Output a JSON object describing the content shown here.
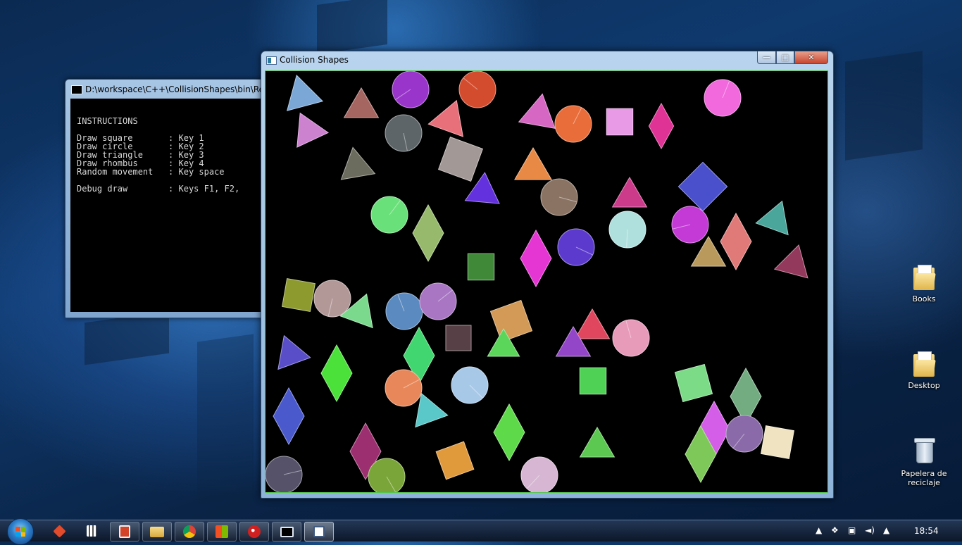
{
  "console": {
    "title": "D:\\workspace\\C++\\CollisionShapes\\bin\\Releas",
    "lines": [
      "INSTRUCTIONS",
      "Draw square       : Key 1",
      "Draw circle       : Key 2",
      "Draw triangle     : Key 3",
      "Draw rhombus      : Key 4",
      "Random movement   : Key space",
      "Debug draw        : Keys F1, F2,"
    ]
  },
  "main_window": {
    "title": "Collision Shapes",
    "minimize_glyph": "—",
    "maximize_glyph": "□",
    "close_glyph": "✕"
  },
  "desktop_icons": {
    "books": "Books",
    "desktop": "Desktop",
    "recycle_bin_line1": "Papelera de",
    "recycle_bin_line2": "reciclaje"
  },
  "taskbar": {
    "clock": "18:54",
    "items": [
      "git-icon",
      "calculator-icon",
      "presentation-icon",
      "explorer-icon",
      "chrome-icon",
      "windows-apps-icon",
      "paint-icon",
      "console-icon",
      "collision-shapes-icon"
    ]
  },
  "colors": {
    "canvas_border": "#55c64f",
    "canvas_background": "#000000"
  },
  "shapes": [
    {
      "type": "triangle",
      "color": "#7aa7d6"
    },
    {
      "type": "triangle",
      "color": "#a56560"
    },
    {
      "type": "circle",
      "color": "#9a35cc"
    },
    {
      "type": "circle",
      "color": "#d44c2e"
    },
    {
      "type": "circle",
      "color": "#f268dd"
    },
    {
      "type": "triangle",
      "color": "#cc82cf"
    },
    {
      "type": "circle",
      "color": "#5d6568"
    },
    {
      "type": "triangle",
      "color": "#e8707b"
    },
    {
      "type": "triangle",
      "color": "#d667c2"
    },
    {
      "type": "circle",
      "color": "#e86d3a"
    },
    {
      "type": "square",
      "color": "#e89ae6"
    },
    {
      "type": "rhombus",
      "color": "#e03396"
    },
    {
      "type": "triangle",
      "color": "#6b6b5e"
    },
    {
      "type": "square",
      "color": "#a29896"
    },
    {
      "type": "triangle",
      "color": "#e88a46"
    },
    {
      "type": "circle",
      "color": "#8a7363"
    },
    {
      "type": "triangle",
      "color": "#cc3a8a"
    },
    {
      "type": "square",
      "color": "#4a4fcc"
    },
    {
      "type": "triangle",
      "color": "#6431df"
    },
    {
      "type": "circle",
      "color": "#6ae07a"
    },
    {
      "type": "rhombus",
      "color": "#96b96b"
    },
    {
      "type": "circle",
      "color": "#b0e0dd"
    },
    {
      "type": "circle",
      "color": "#c43ad6"
    },
    {
      "type": "rhombus",
      "color": "#e07a78"
    },
    {
      "type": "triangle",
      "color": "#4aa59a"
    },
    {
      "type": "circle",
      "color": "#5c3acd"
    },
    {
      "type": "rhombus",
      "color": "#e535d3"
    },
    {
      "type": "square",
      "color": "#408939"
    },
    {
      "type": "triangle",
      "color": "#b99a5c"
    },
    {
      "type": "triangle",
      "color": "#93395c"
    },
    {
      "type": "square",
      "color": "#8c9a2e"
    },
    {
      "type": "circle",
      "color": "#b39898"
    },
    {
      "type": "triangle",
      "color": "#7ad98c"
    },
    {
      "type": "circle",
      "color": "#5b8ac0"
    },
    {
      "type": "circle",
      "color": "#a876c2"
    },
    {
      "type": "square",
      "color": "#d29a56"
    },
    {
      "type": "square",
      "color": "#574046"
    },
    {
      "type": "triangle",
      "color": "#e0475e"
    },
    {
      "type": "circle",
      "color": "#e89ab9"
    },
    {
      "type": "triangle",
      "color": "#9446c8"
    },
    {
      "type": "triangle",
      "color": "#5a4ec8"
    },
    {
      "type": "rhombus",
      "color": "#4ce03a"
    },
    {
      "type": "rhombus",
      "color": "#42d670"
    },
    {
      "type": "triangle",
      "color": "#5cd65a"
    },
    {
      "type": "circle",
      "color": "#e8885a"
    },
    {
      "type": "circle",
      "color": "#a8c8e8"
    },
    {
      "type": "square",
      "color": "#4fd155"
    },
    {
      "type": "square",
      "color": "#7bdb86"
    },
    {
      "type": "rhombus",
      "color": "#72ac80"
    },
    {
      "type": "triangle",
      "color": "#5ac8c8"
    },
    {
      "type": "rhombus",
      "color": "#4a5acd"
    },
    {
      "type": "rhombus",
      "color": "#9c2f6f"
    },
    {
      "type": "square",
      "color": "#e09a3c"
    },
    {
      "type": "rhombus",
      "color": "#5ed94a"
    },
    {
      "type": "triangle",
      "color": "#5cc852"
    },
    {
      "type": "rhombus",
      "color": "#d55ee8"
    },
    {
      "type": "circle",
      "color": "#8a6aa8"
    },
    {
      "type": "square",
      "color": "#efe3c2"
    },
    {
      "type": "rhombus",
      "color": "#7ec85a"
    },
    {
      "type": "circle",
      "color": "#55526a"
    },
    {
      "type": "circle",
      "color": "#7aa539"
    },
    {
      "type": "circle",
      "color": "#d6b6d2"
    }
  ]
}
